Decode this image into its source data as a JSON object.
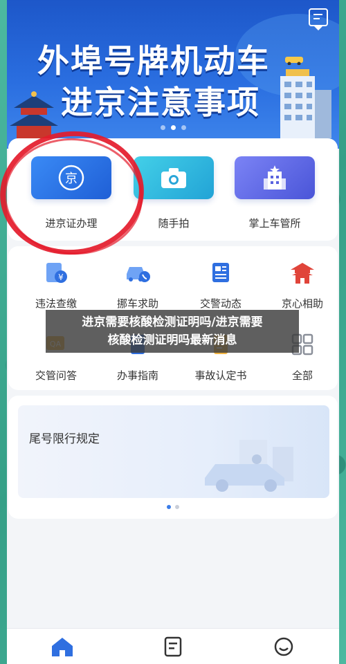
{
  "banner": {
    "line1": "外埠号牌机动车",
    "line2": "进京注意事项",
    "dots": [
      false,
      true,
      false
    ]
  },
  "services": [
    {
      "label": "进京证办理",
      "icon": "jing-seal-icon"
    },
    {
      "label": "随手拍",
      "icon": "camera-icon"
    },
    {
      "label": "掌上车管所",
      "icon": "office-building-icon"
    }
  ],
  "grid": [
    {
      "label": "违法查缴",
      "icon": "yuan-document-icon"
    },
    {
      "label": "挪车求助",
      "icon": "car-phone-icon"
    },
    {
      "label": "交警动态",
      "icon": "news-icon"
    },
    {
      "label": "京心相助",
      "icon": "temple-icon"
    },
    {
      "label": "交管问答",
      "icon": "qa-chat-icon"
    },
    {
      "label": "办事指南",
      "icon": "guide-book-icon"
    },
    {
      "label": "事故认定书",
      "icon": "accident-doc-icon"
    },
    {
      "label": "全部",
      "icon": "grid-all-icon"
    }
  ],
  "overlay": {
    "line1": "进京需要核酸检测证明吗/进京需要",
    "line2": "核酸检测证明吗最新消息"
  },
  "promo": {
    "title": "尾号限行规定",
    "dots": [
      true,
      false
    ]
  },
  "tabs": [
    {
      "name": "home-icon"
    },
    {
      "name": "document-icon"
    },
    {
      "name": "smile-icon"
    }
  ],
  "colors": {
    "accent": "#2a6ee0",
    "circle": "#e41b2b"
  }
}
